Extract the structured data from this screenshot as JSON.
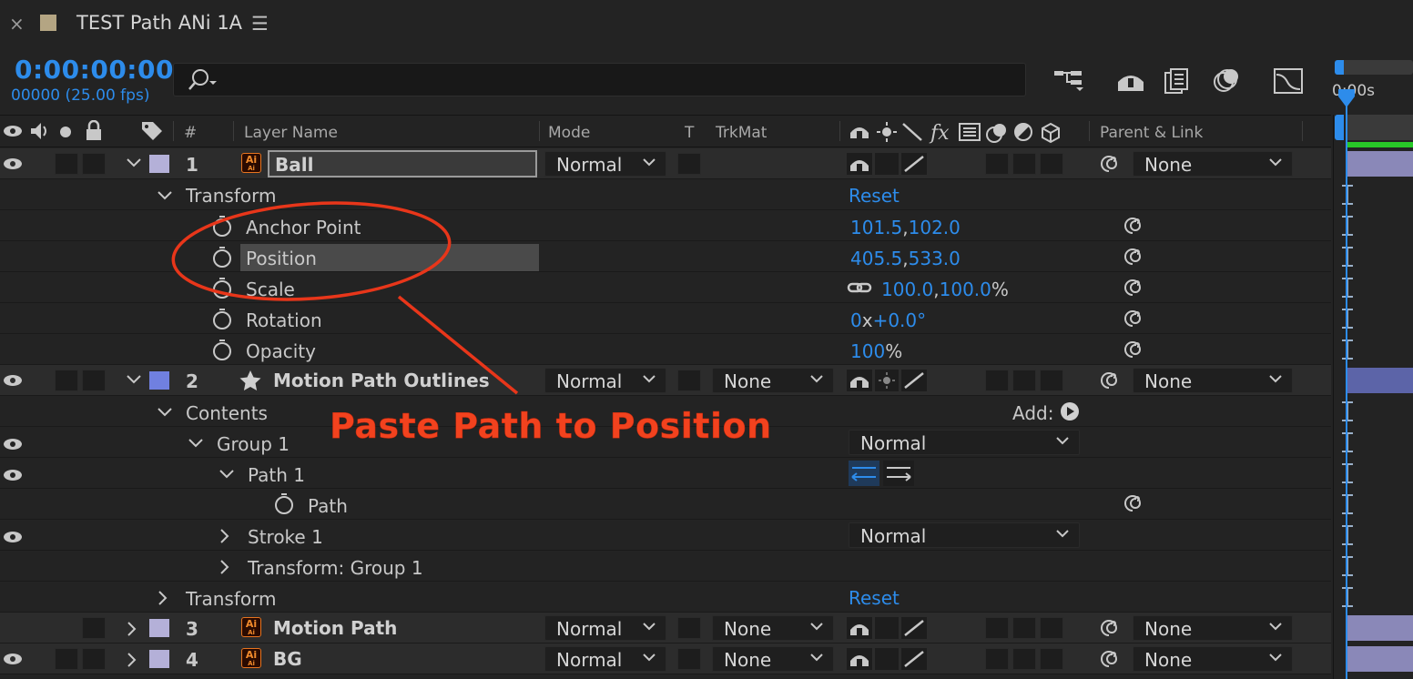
{
  "title_bar": {
    "close_glyph": "×",
    "comp_name": "TEST Path ANi 1A",
    "menu_glyph": "☰"
  },
  "time": {
    "timecode": "0:00:00:00",
    "frames": "00000 (25.00 fps)"
  },
  "search": {
    "placeholder": "",
    "value": ""
  },
  "timeline": {
    "time_label": "0:00s"
  },
  "columns": {
    "num": "#",
    "layer_name": "Layer Name",
    "mode": "Mode",
    "t": "T",
    "trkmat": "TrkMat",
    "fx": "fx",
    "parent": "Parent & Link"
  },
  "layers": [
    {
      "num": "1",
      "name": "Ball",
      "type": "ai",
      "mode": "Normal",
      "trkmat": "",
      "parent": "None",
      "label_color": "#b4b0d8"
    },
    {
      "num": "2",
      "name": "Motion Path Outlines",
      "type": "shape",
      "mode": "Normal",
      "trkmat": "None",
      "parent": "None",
      "label_color": "#7080e0"
    },
    {
      "num": "3",
      "name": "Motion Path",
      "type": "ai",
      "mode": "Normal",
      "trkmat": "None",
      "parent": "None",
      "label_color": "#b4b0d8"
    },
    {
      "num": "4",
      "name": "BG",
      "type": "ai",
      "mode": "Normal",
      "trkmat": "None",
      "parent": "None",
      "label_color": "#b4b0d8"
    }
  ],
  "ai_badge": {
    "top": "Ai",
    "bottom": "Ai"
  },
  "transform1": {
    "label": "Transform",
    "reset": "Reset",
    "props": [
      {
        "name": "Anchor Point",
        "value_a": "101.5",
        "sep": ",",
        "value_b": "102.0",
        "unit": ""
      },
      {
        "name": "Position",
        "value_a": "405.5",
        "sep": ",",
        "value_b": "533.0",
        "unit": ""
      },
      {
        "name": "Scale",
        "value_a": "100.0",
        "sep": ",",
        "value_b": "100.0",
        "unit": "%"
      },
      {
        "name": "Rotation",
        "value_a": "0",
        "sep": "x",
        "value_b": "+0.0°",
        "unit": ""
      },
      {
        "name": "Opacity",
        "value_a": "100",
        "sep": "",
        "value_b": "",
        "unit": "%"
      }
    ]
  },
  "contents": {
    "label": "Contents",
    "add_label": "Add:",
    "group1": "Group 1",
    "group1_mode": "Normal",
    "path1": "Path 1",
    "path": "Path",
    "stroke1": "Stroke 1",
    "stroke1_mode": "Normal",
    "transform_group": "Transform: Group 1"
  },
  "transform2": {
    "label": "Transform",
    "reset": "Reset"
  },
  "annotation": {
    "text": "Paste Path to Position",
    "color": "#f2421e"
  },
  "colors": {
    "accent": "#2d8ceb",
    "bg": "#232323",
    "layer_row": "#2c2c2c",
    "green_bar": "#28c828"
  }
}
